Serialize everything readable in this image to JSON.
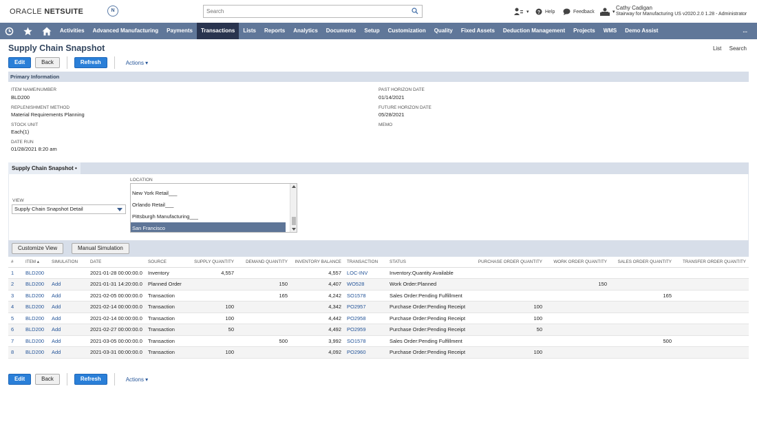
{
  "header": {
    "logo_oracle": "ORACLE",
    "logo_netsuite": "NETSUITE",
    "badge": "N",
    "search_placeholder": "Search",
    "help": "Help",
    "feedback": "Feedback",
    "user_name": "Cathy Cadigan",
    "user_role": "Stairway for Manufacturing US v2020.2.0 1.28 - Administrator"
  },
  "nav": {
    "items": [
      "Activities",
      "Advanced Manufacturing",
      "Payments",
      "Transactions",
      "Lists",
      "Reports",
      "Analytics",
      "Documents",
      "Setup",
      "Customization",
      "Quality",
      "Fixed Assets",
      "Deduction Management",
      "Projects",
      "WMS",
      "Demo Assist",
      "..."
    ],
    "active": "Transactions"
  },
  "page": {
    "title": "Supply Chain Snapshot",
    "list_link": "List",
    "search_link": "Search",
    "edit": "Edit",
    "back": "Back",
    "refresh": "Refresh",
    "actions": "Actions ▾"
  },
  "primary": {
    "header": "Primary Information",
    "item_label": "ITEM NAME/NUMBER",
    "item_value": "BLD200",
    "repl_label": "REPLENISHMENT METHOD",
    "repl_value": "Material Requirements Planning",
    "stock_label": "STOCK UNIT",
    "stock_value": "Each(1)",
    "daterun_label": "DATE RUN",
    "daterun_value": "01/28/2021 8:20 am",
    "past_label": "PAST HORIZON DATE",
    "past_value": "01/14/2021",
    "future_label": "FUTURE HORIZON DATE",
    "future_value": "05/28/2021",
    "memo_label": "MEMO"
  },
  "snapshot": {
    "tab_label": "Supply Chain Snapshot •",
    "view_label": "VIEW",
    "view_value": "Supply Chain Snapshot Detail",
    "location_label": "LOCATION",
    "locations": [
      "New York Retail___",
      "Orlando Retail___",
      "Pittsburgh Manufacturing___",
      "San Francisco"
    ],
    "selected_location": "San Francisco",
    "customize_view": "Customize View",
    "manual_simulation": "Manual Simulation"
  },
  "table": {
    "columns": [
      "#",
      "ITEM ▴",
      "SIMULATION",
      "DATE",
      "SOURCE",
      "SUPPLY QUANTITY",
      "DEMAND QUANTITY",
      "INVENTORY BALANCE",
      "TRANSACTION",
      "STATUS",
      "PURCHASE ORDER QUANTITY",
      "WORK ORDER QUANTITY",
      "SALES ORDER QUANTITY",
      "TRANSFER ORDER QUANTITY"
    ],
    "rows": [
      {
        "n": "1",
        "item": "BLD200",
        "sim": "",
        "date": "2021-01-28 00:00:00.0",
        "source": "Inventory",
        "supply": "4,557",
        "demand": "",
        "balance": "4,557",
        "txn": "LOC-INV",
        "status": "Inventory:Quantity Available",
        "po": "",
        "wo": "",
        "so": "",
        "to": ""
      },
      {
        "n": "2",
        "item": "BLD200",
        "sim": "Add",
        "date": "2021-01-31 14:20:00.0",
        "source": "Planned Order",
        "supply": "",
        "demand": "150",
        "balance": "4,407",
        "txn": "WO528",
        "status": "Work Order:Planned",
        "po": "",
        "wo": "150",
        "so": "",
        "to": ""
      },
      {
        "n": "3",
        "item": "BLD200",
        "sim": "Add",
        "date": "2021-02-05 00:00:00.0",
        "source": "Transaction",
        "supply": "",
        "demand": "165",
        "balance": "4,242",
        "txn": "SO1578",
        "status": "Sales Order:Pending Fulfillment",
        "po": "",
        "wo": "",
        "so": "165",
        "to": ""
      },
      {
        "n": "4",
        "item": "BLD200",
        "sim": "Add",
        "date": "2021-02-14 00:00:00.0",
        "source": "Transaction",
        "supply": "100",
        "demand": "",
        "balance": "4,342",
        "txn": "PO2957",
        "status": "Purchase Order:Pending Receipt",
        "po": "100",
        "wo": "",
        "so": "",
        "to": ""
      },
      {
        "n": "5",
        "item": "BLD200",
        "sim": "Add",
        "date": "2021-02-14 00:00:00.0",
        "source": "Transaction",
        "supply": "100",
        "demand": "",
        "balance": "4,442",
        "txn": "PO2958",
        "status": "Purchase Order:Pending Receipt",
        "po": "100",
        "wo": "",
        "so": "",
        "to": ""
      },
      {
        "n": "6",
        "item": "BLD200",
        "sim": "Add",
        "date": "2021-02-27 00:00:00.0",
        "source": "Transaction",
        "supply": "50",
        "demand": "",
        "balance": "4,492",
        "txn": "PO2959",
        "status": "Purchase Order:Pending Receipt",
        "po": "50",
        "wo": "",
        "so": "",
        "to": ""
      },
      {
        "n": "7",
        "item": "BLD200",
        "sim": "Add",
        "date": "2021-03-05 00:00:00.0",
        "source": "Transaction",
        "supply": "",
        "demand": "500",
        "balance": "3,992",
        "txn": "SO1578",
        "status": "Sales Order:Pending Fulfillment",
        "po": "",
        "wo": "",
        "so": "500",
        "to": ""
      },
      {
        "n": "8",
        "item": "BLD200",
        "sim": "Add",
        "date": "2021-03-31 00:00:00.0",
        "source": "Transaction",
        "supply": "100",
        "demand": "",
        "balance": "4,092",
        "txn": "PO2960",
        "status": "Purchase Order:Pending Receipt",
        "po": "100",
        "wo": "",
        "so": "",
        "to": ""
      }
    ]
  }
}
